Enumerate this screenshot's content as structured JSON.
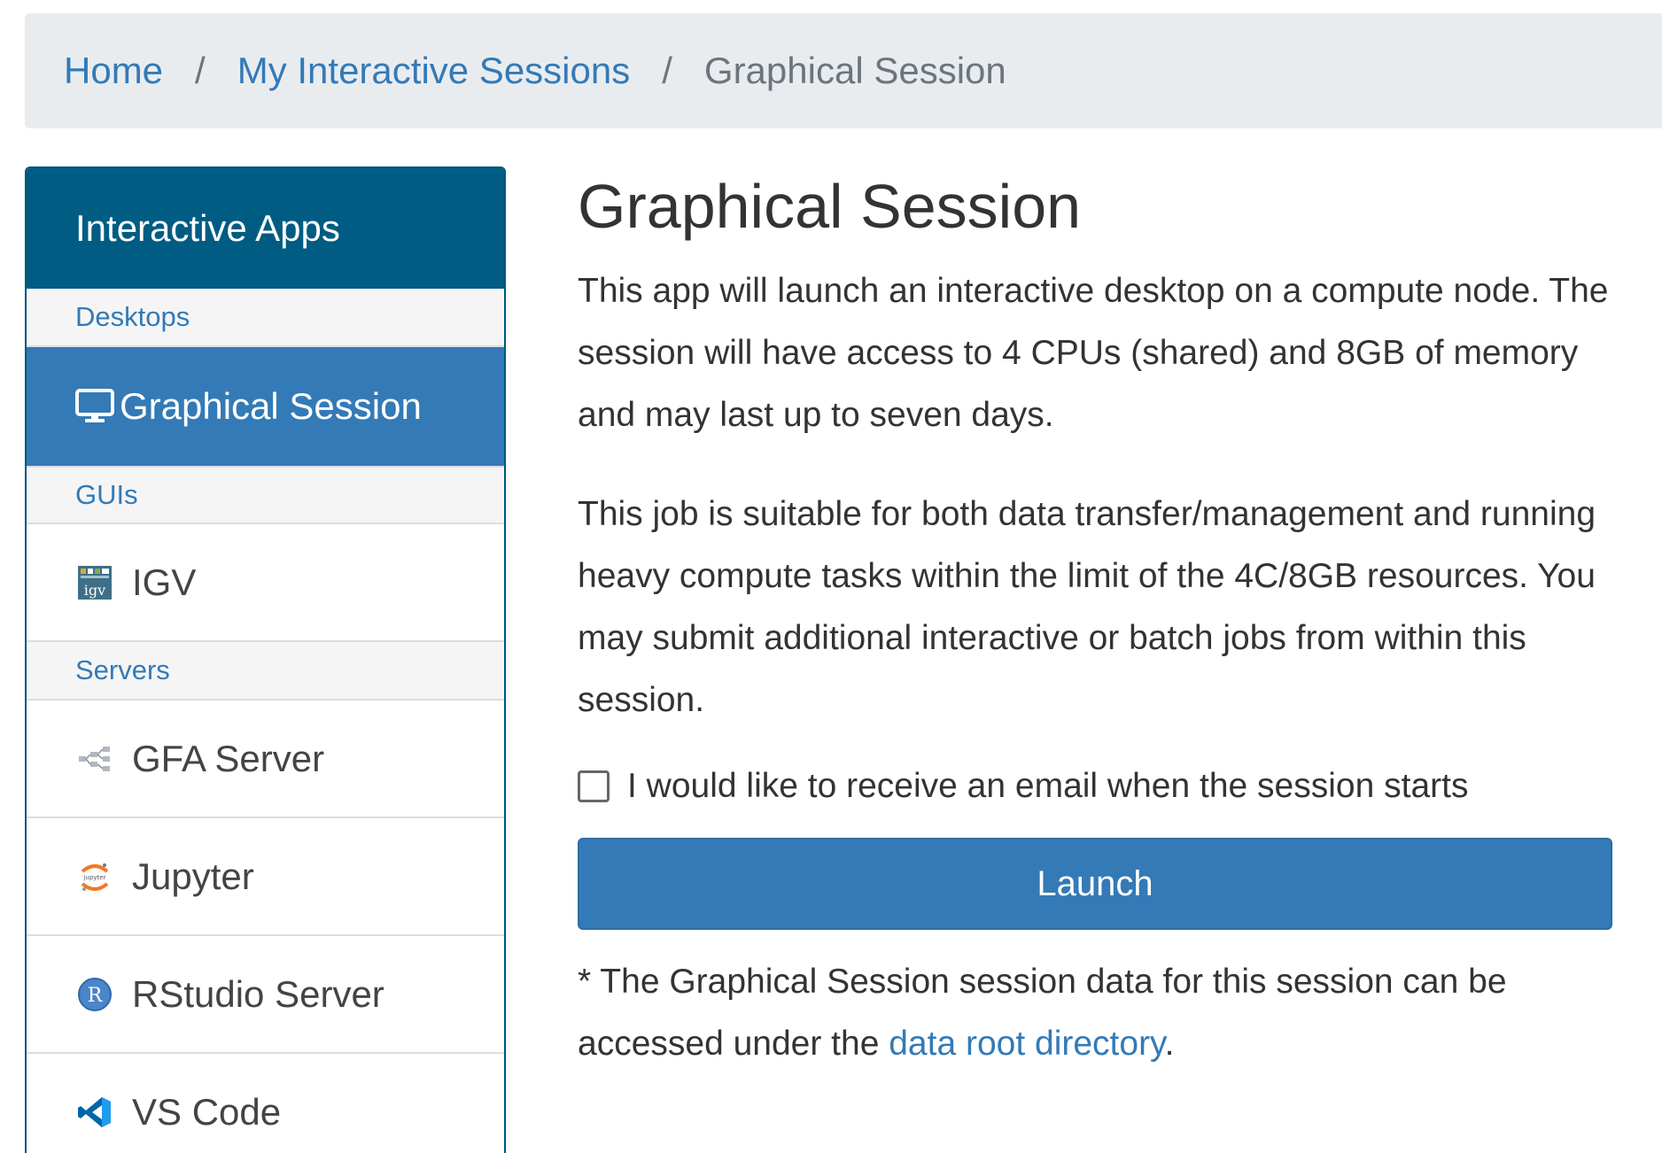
{
  "breadcrumb": {
    "home": "Home",
    "sessions": "My Interactive Sessions",
    "current": "Graphical Session",
    "separator": "/"
  },
  "sidebar": {
    "header": "Interactive Apps",
    "categories": {
      "desktops": "Desktops",
      "guis": "GUIs",
      "servers": "Servers"
    },
    "items": [
      {
        "label": "Graphical Session",
        "icon": "desktop-icon",
        "active": true
      },
      {
        "label": "IGV",
        "icon": "igv-icon"
      },
      {
        "label": "GFA Server",
        "icon": "gfa-icon"
      },
      {
        "label": "Jupyter",
        "icon": "jupyter-icon"
      },
      {
        "label": "RStudio Server",
        "icon": "rstudio-icon"
      },
      {
        "label": "VS Code",
        "icon": "vscode-icon"
      }
    ]
  },
  "main": {
    "title": "Graphical Session",
    "description_1": "This app will launch an interactive desktop on a compute node. The session will have access to 4 CPUs (shared) and 8GB of memory and may last up to seven days.",
    "description_2": "This job is suitable for both data transfer/management and running heavy compute tasks within the limit of the 4C/8GB resources. You may submit additional interactive or batch jobs from within this session.",
    "email_checkbox_label": "I would like to receive an email when the session starts",
    "email_checkbox_checked": false,
    "launch_label": "Launch",
    "note_prefix": "* The Graphical Session session data for this session can be accessed under the ",
    "note_link": "data root directory",
    "note_suffix": "."
  },
  "colors": {
    "primary": "#337ab7",
    "sidebar_header": "#005c83",
    "breadcrumb_bg": "#e9ecef"
  }
}
